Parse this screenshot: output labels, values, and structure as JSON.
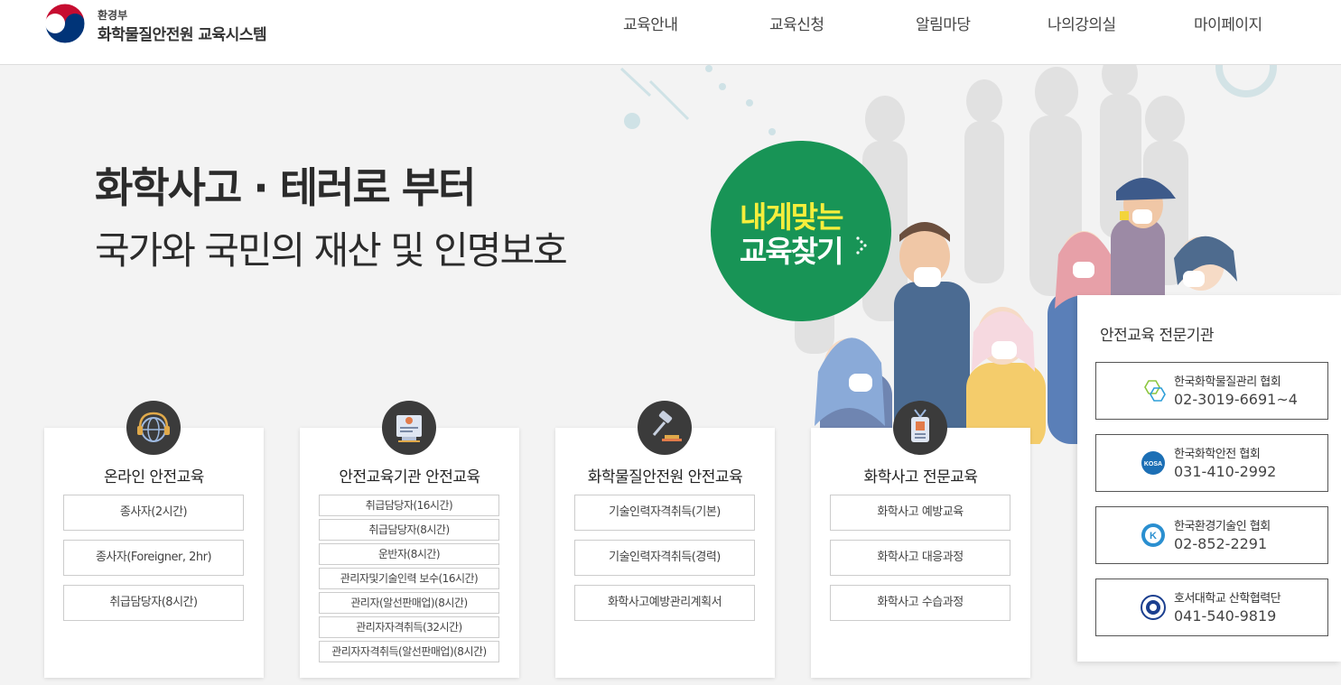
{
  "header": {
    "logo_small": "환경부",
    "logo_main": "화학물질안전원 교육시스템",
    "nav": [
      "교육안내",
      "교육신청",
      "알림마당",
      "나의강의실",
      "마이페이지"
    ]
  },
  "hero": {
    "line1": "화학사고 · 테러로 부터",
    "line2": "국가와 국민의 재산 및 인명보호",
    "find_line1": "내게맞는",
    "find_line2": "교육찾기"
  },
  "cards": [
    {
      "title": "온라인 안전교육",
      "icon": "headset-globe-icon",
      "items": [
        "종사자(2시간)",
        "종사자(Foreigner, 2hr)",
        "취급담당자(8시간)"
      ]
    },
    {
      "title": "안전교육기관 안전교육",
      "icon": "presentation-board-icon",
      "items": [
        "취급담당자(16시간)",
        "취급담당자(8시간)",
        "운반자(8시간)",
        "관리자및기술인력 보수(16시간)",
        "관리자(알선판매업)(8시간)",
        "관리자자격취득(32시간)",
        "관리자자격취득(알선판매업)(8시간)"
      ]
    },
    {
      "title": "화학물질안전원 안전교육",
      "icon": "gavel-icon",
      "items": [
        "기술인력자격취득(기본)",
        "기술인력자격취득(경력)",
        "화학사고예방관리계획서"
      ]
    },
    {
      "title": "화학사고 전문교육",
      "icon": "id-badge-icon",
      "items": [
        "화학사고 예방교육",
        "화학사고 대응과정",
        "화학사고 수습과정"
      ]
    }
  ],
  "side": {
    "title": "안전교육 전문기관",
    "orgs": [
      {
        "name": "한국화학물질관리 협회",
        "tel": "02-3019-6691~4",
        "icon": "hexagon-logo-icon",
        "color": "#2e9fd8"
      },
      {
        "name": "한국화학안전 협회",
        "tel": "031-410-2992",
        "icon": "kosa-logo-icon",
        "color": "#1c6fb5"
      },
      {
        "name": "한국환경기술인 협회",
        "tel": "02-852-2291",
        "icon": "k-logo-icon",
        "color": "#2a8fd0"
      },
      {
        "name": "호서대학교 산학협력단",
        "tel": "041-540-9819",
        "icon": "university-seal-icon",
        "color": "#1b3f8f"
      }
    ]
  },
  "colors": {
    "find_button": "#189456",
    "find_highlight": "#f6ee3c",
    "icon_circle": "#3b3b3b"
  }
}
